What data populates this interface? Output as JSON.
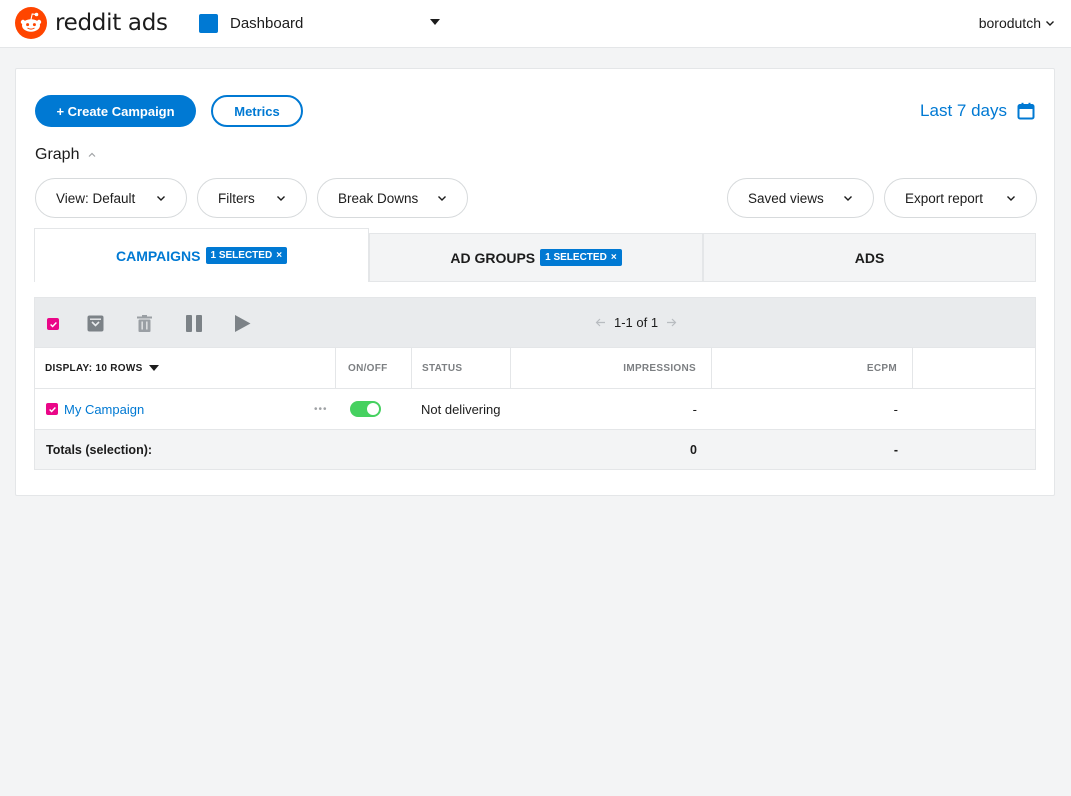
{
  "topbar": {
    "brand": "reddit ads",
    "account_label": "Dashboard",
    "username": "borodutch"
  },
  "actions": {
    "create_campaign": "+ Create Campaign",
    "metrics": "Metrics",
    "date_range": "Last 7 days"
  },
  "graph": {
    "label": "Graph"
  },
  "filters": {
    "view": "View: Default",
    "filters": "Filters",
    "breakdowns": "Break Downs",
    "saved_views": "Saved views",
    "export": "Export report"
  },
  "tabs": [
    {
      "label": "CAMPAIGNS",
      "badge": "1 SELECTED",
      "active": true
    },
    {
      "label": "AD GROUPS",
      "badge": "1 SELECTED",
      "active": false
    },
    {
      "label": "ADS",
      "badge": "",
      "active": false
    }
  ],
  "badge_close": "×",
  "table": {
    "pagination": "1-1 of 1",
    "display_rows": "DISPLAY: 10 ROWS",
    "columns": {
      "onoff": "ON/OFF",
      "status": "STATUS",
      "impressions": "IMPRESSIONS",
      "ecpm": "ECPM"
    },
    "rows": [
      {
        "name": "My Campaign",
        "enabled": true,
        "status": "Not delivering",
        "impressions": "-",
        "ecpm": "-"
      }
    ],
    "totals": {
      "label": "Totals (selection):",
      "impressions": "0",
      "ecpm": "-"
    },
    "more_dots": "•••"
  },
  "colors": {
    "accent": "#0079d3",
    "brand_orange": "#ff4500",
    "checkbox_pink": "#ea0688",
    "toggle_green": "#46d160"
  }
}
